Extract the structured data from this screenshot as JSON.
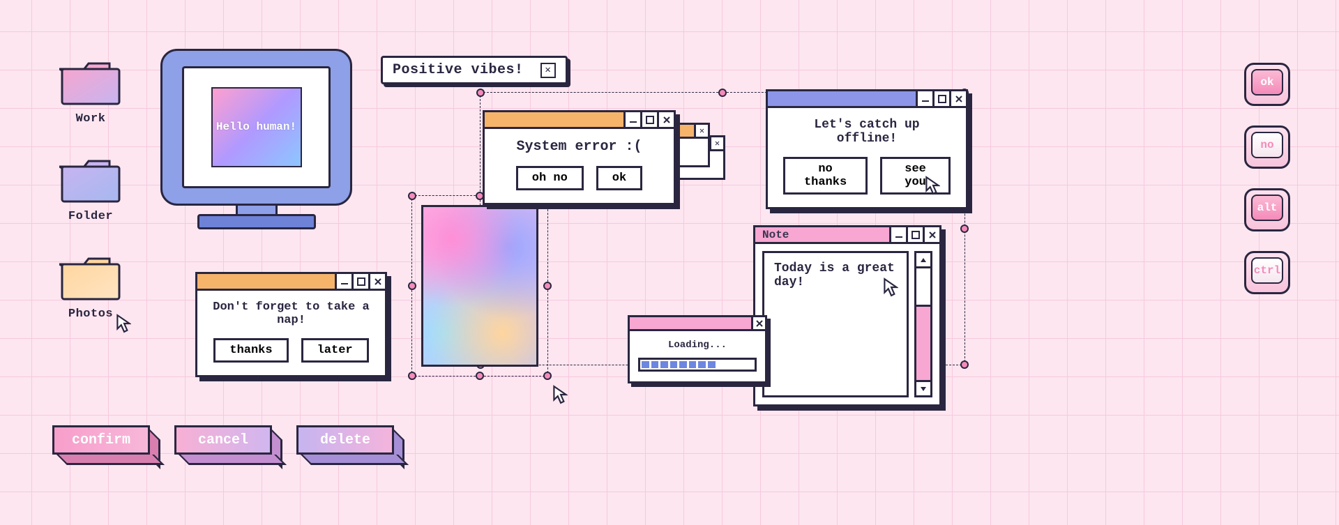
{
  "folders": {
    "work": {
      "label": "Work",
      "grad": [
        "#f6a6cf",
        "#c7b4f0"
      ]
    },
    "folder": {
      "label": "Folder",
      "grad": [
        "#c7b4f0",
        "#a6b8f0"
      ]
    },
    "photos": {
      "label": "Photos",
      "grad": [
        "#ffd6a0",
        "#ffe4c2"
      ]
    }
  },
  "monitor": {
    "text": "Hello human!"
  },
  "pill": {
    "text": "Positive vibes!"
  },
  "nap_dialog": {
    "message": "Don't forget to take a nap!",
    "btn1": "thanks",
    "btn2": "later"
  },
  "error_dialog": {
    "message": "System error :(",
    "btn1": "oh no",
    "btn2": "ok"
  },
  "offline_dialog": {
    "message": "Let's catch up offline!",
    "btn1": "no thanks",
    "btn2": "see you"
  },
  "loading": {
    "label": "Loading...",
    "filled": 8,
    "total": 12
  },
  "note": {
    "title": "Note",
    "text": "Today is a great day!"
  },
  "big_buttons": {
    "confirm": "confirm",
    "cancel": "cancel",
    "delete": "delete"
  },
  "keys": {
    "ok": "ok",
    "no": "no",
    "alt": "alt",
    "ctrl": "ctrl"
  }
}
